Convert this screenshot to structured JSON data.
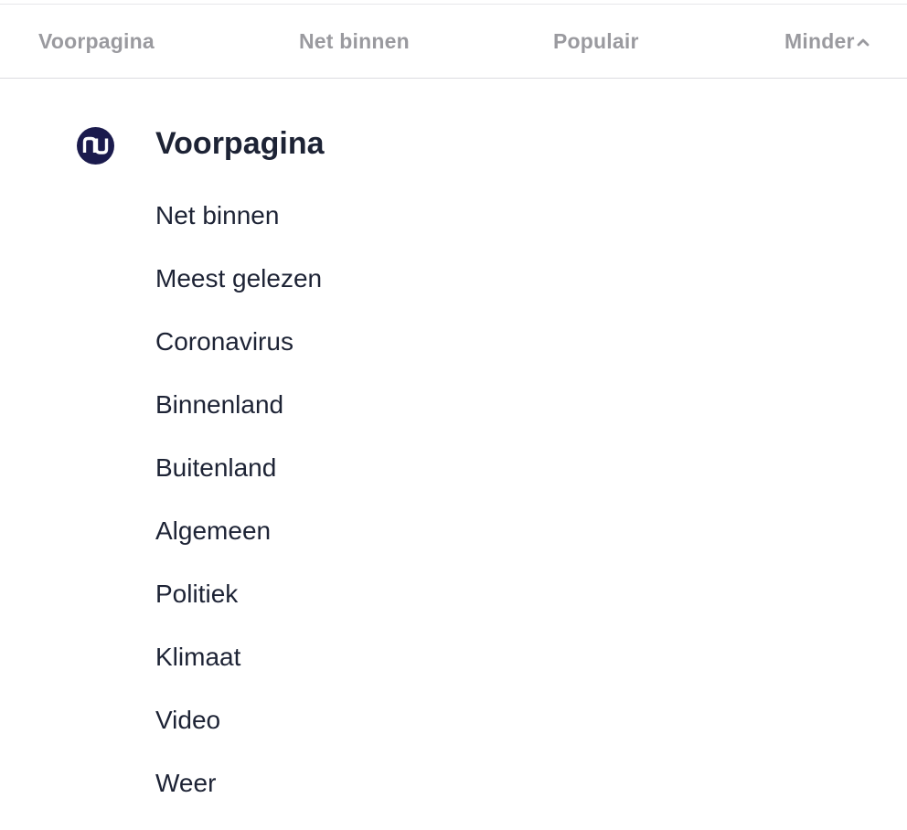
{
  "tabs": [
    {
      "label": "Voorpagina"
    },
    {
      "label": "Net binnen"
    },
    {
      "label": "Populair"
    },
    {
      "label": "Minder",
      "icon": "chevron-up-icon"
    }
  ],
  "brand": {
    "logo_text": "nu",
    "logo_color": "#1b1b4d"
  },
  "section": {
    "title": "Voorpagina",
    "items": [
      {
        "label": "Net binnen"
      },
      {
        "label": "Meest gelezen"
      },
      {
        "label": "Coronavirus"
      },
      {
        "label": "Binnenland"
      },
      {
        "label": "Buitenland"
      },
      {
        "label": "Algemeen"
      },
      {
        "label": "Politiek"
      },
      {
        "label": "Klimaat"
      },
      {
        "label": "Video"
      },
      {
        "label": "Weer"
      }
    ]
  },
  "colors": {
    "tab_text": "#9a9a9f",
    "body_text": "#1d2335",
    "divider": "#dcdce0"
  }
}
